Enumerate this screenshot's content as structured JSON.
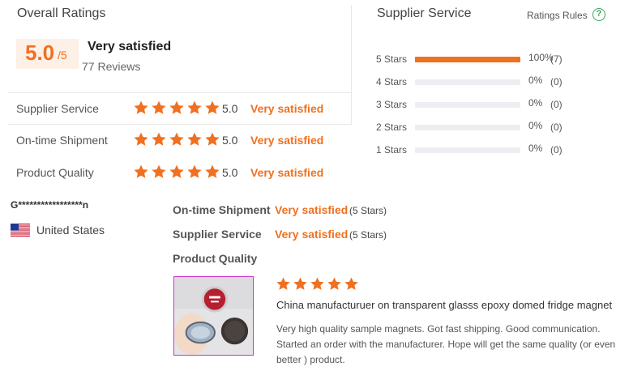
{
  "overall": {
    "title": "Overall Ratings",
    "score": "5.0",
    "score_denominator": "/5",
    "label": "Very satisfied",
    "reviews": "77 Reviews"
  },
  "metrics": [
    {
      "name": "Supplier Service",
      "score": "5.0",
      "label": "Very satisfied",
      "stars": 5
    },
    {
      "name": "On-time Shipment",
      "score": "5.0",
      "label": "Very satisfied",
      "stars": 5
    },
    {
      "name": "Product Quality",
      "score": "5.0",
      "label": "Very satisfied",
      "stars": 5
    }
  ],
  "supplier_service": {
    "title": "Supplier Service",
    "rules_label": "Ratings Rules",
    "rules_icon": "?",
    "distribution": [
      {
        "label": "5 Stars",
        "percent": "100%",
        "count": "(7)",
        "fraction": 1.0
      },
      {
        "label": "4 Stars",
        "percent": "0%",
        "count": "(0)",
        "fraction": 0
      },
      {
        "label": "3 Stars",
        "percent": "0%",
        "count": "(0)",
        "fraction": 0
      },
      {
        "label": "2 Stars",
        "percent": "0%",
        "count": "(0)",
        "fraction": 0
      },
      {
        "label": "1 Stars",
        "percent": "0%",
        "count": "(0)",
        "fraction": 0
      }
    ]
  },
  "review": {
    "reviewer": "G*****************n",
    "country": "United States",
    "flag_icon": "us-flag-icon",
    "lines": [
      {
        "key": "On-time Shipment",
        "value": "Very satisfied",
        "stars": "(5 Stars)"
      },
      {
        "key": "Supplier Service",
        "value": "Very satisfied",
        "stars": "(5 Stars)"
      },
      {
        "key": "Product Quality",
        "value": "",
        "stars": ""
      }
    ],
    "product_rating": 5,
    "product_name": "China manufacturuer on transparent glasss epoxy domed fridge magnet",
    "text": "Very high quality sample magnets. Got fast shipping. Good communication. Started an order with the manufacturer. Hope will get the same quality (or even better ) product."
  },
  "colors": {
    "accent": "#f07020",
    "track": "#eceef2",
    "rules_icon": "#3aa55d"
  }
}
